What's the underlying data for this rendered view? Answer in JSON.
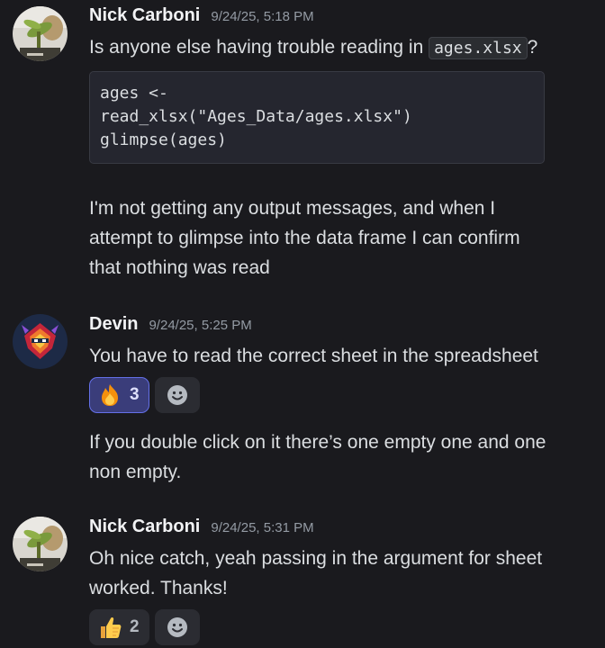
{
  "messages": [
    {
      "author": "Nick Carboni",
      "timestamp": "9/24/25, 5:18 PM",
      "text_before_code": "Is anyone else having trouble reading in ",
      "inline_code": "ages.xlsx",
      "text_after_code": "?",
      "code_block": [
        "ages <-",
        "read_xlsx(\"Ages_Data/ages.xlsx\")",
        "glimpse(ages)"
      ],
      "followup_lines": [
        "I'm not getting any output messages, and when I",
        "attempt to glimpse into the data frame I can confirm",
        "that nothing was read"
      ]
    },
    {
      "author": "Devin",
      "timestamp": "9/24/25, 5:25 PM",
      "text": "You have to read the correct sheet in the spreadsheet",
      "reaction": {
        "emoji": "fire-emoji",
        "count": "3"
      },
      "followup_lines": [
        "If you double click on it there’s one empty one and one",
        "non empty."
      ]
    },
    {
      "author": "Nick Carboni",
      "timestamp": "9/24/25, 5:31 PM",
      "text_lines": [
        "Oh nice catch, yeah passing in the argument for sheet",
        "worked. Thanks!"
      ],
      "reaction": {
        "emoji": "thumbs-up-emoji",
        "count": "2"
      }
    }
  ],
  "colors": {
    "background": "#1a1a1e",
    "text": "#dbdee1",
    "timestamp": "#949ba4",
    "reaction_active_bg": "#3a3d7a",
    "reaction_active_border": "#6470e8"
  }
}
